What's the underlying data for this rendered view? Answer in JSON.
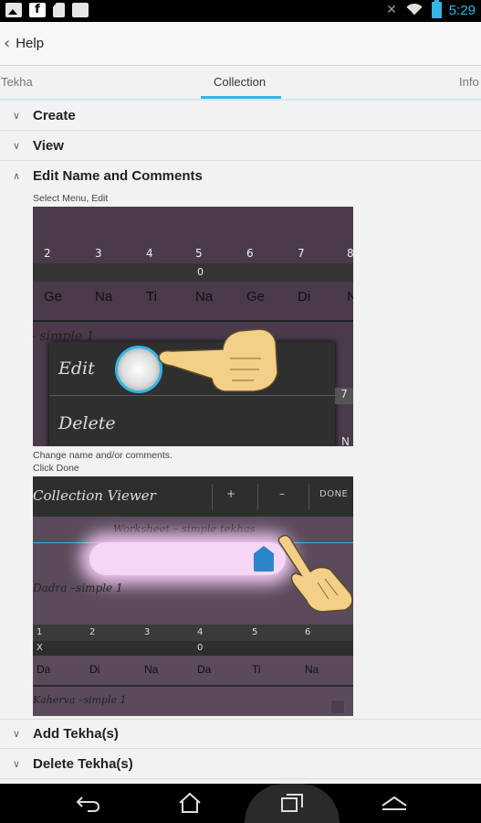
{
  "status_bar": {
    "time": "5:29",
    "icons": [
      "image-icon",
      "facebook-icon",
      "sd-card-icon",
      "briefcase-icon",
      "mute-icon",
      "wifi-icon",
      "battery-icon"
    ]
  },
  "action_bar": {
    "title": "Help"
  },
  "tabs": [
    {
      "label": "Tekha",
      "selected": false
    },
    {
      "label": "Collection",
      "selected": true
    },
    {
      "label": "Info",
      "selected": false
    }
  ],
  "sections": {
    "create": "Create",
    "view": "View",
    "edit": "Edit Name and Comments",
    "add": "Add Tekha(s)",
    "delete": "Delete Tekha(s)"
  },
  "edit_section": {
    "caption1": "Select Menu, Edit",
    "caption2_line1": "Change name and/or comments.",
    "caption2_line2": "Click Done",
    "shot1": {
      "beats": [
        "2",
        "3",
        "4",
        "5",
        "6",
        "7",
        "8"
      ],
      "zero": "0",
      "bols": [
        "Ge",
        "Na",
        "Ti",
        "Na",
        "Ge",
        "Di",
        "N"
      ],
      "script": "– simple 1",
      "menu_edit": "Edit",
      "menu_delete": "Delete",
      "strip_num": "7",
      "strip_n": "N"
    },
    "shot2": {
      "title": "Collection Viewer",
      "plus": "+",
      "minus": "–",
      "done": "DONE",
      "field_text": "Worksheet – simple tekhas",
      "row_name": "Dadra –simple 1",
      "beats": [
        "1",
        "2",
        "3",
        "4",
        "5",
        "6"
      ],
      "x_mark": "X",
      "zero": "0",
      "bols": [
        "Da",
        "Di",
        "Na",
        "Da",
        "Ti",
        "Na"
      ],
      "row_name2": "Kaherva –simple 1"
    }
  },
  "colors": {
    "accent": "#33b5e5",
    "screen_bg": "#4a3a4c"
  }
}
